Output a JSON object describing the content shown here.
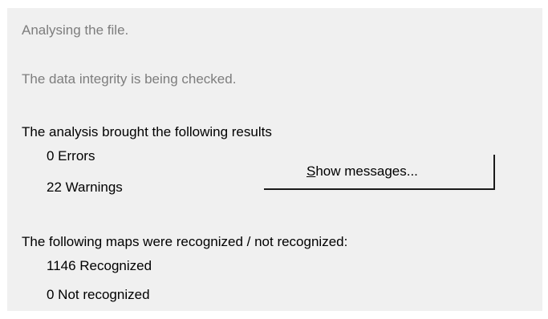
{
  "status": {
    "analysing": "Analysing the file.",
    "integrity": "The data integrity is being checked."
  },
  "analysis": {
    "heading": "The analysis brought the following results",
    "errors": "0 Errors",
    "warnings": "22 Warnings",
    "show_messages_label": "Show messages..."
  },
  "maps": {
    "heading": "The following maps were recognized / not recognized:",
    "recognized": "1146 Recognized",
    "not_recognized": "0 Not recognized"
  },
  "colors": {
    "panel_background": "#f0f0f0",
    "muted_text": "#7d7d7d",
    "text": "#000000"
  }
}
